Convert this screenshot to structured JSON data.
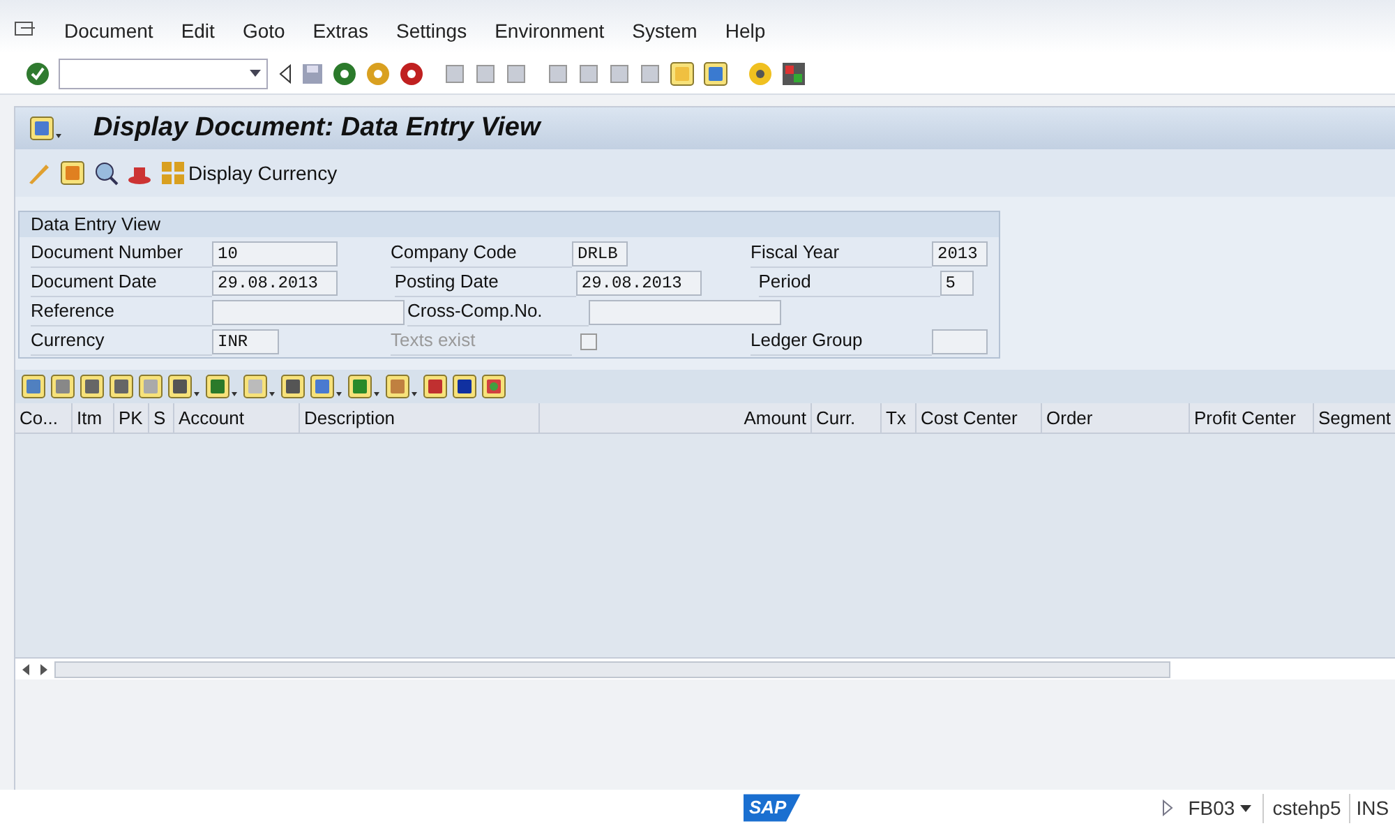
{
  "menu_bar": {
    "items": [
      "Document",
      "Edit",
      "Goto",
      "Extras",
      "Settings",
      "Environment",
      "System",
      "Help"
    ]
  },
  "title": "Display Document: Data Entry View",
  "app_toolbar": {
    "button_label": "Display Currency"
  },
  "panel": {
    "title": "Data Entry View",
    "rows": [
      [
        {
          "kind": "field",
          "label": "Document Number",
          "value": "10"
        },
        {
          "kind": "field",
          "label": "Company Code",
          "value": "DRLB"
        },
        {
          "kind": "field",
          "label": "Fiscal Year",
          "value": "2013"
        }
      ],
      [
        {
          "kind": "field",
          "label": "Document Date",
          "value": "29.08.2013"
        },
        {
          "kind": "field",
          "label": "Posting Date",
          "value": "29.08.2013"
        },
        {
          "kind": "field",
          "label": "Period",
          "value": "5"
        }
      ],
      [
        {
          "kind": "field",
          "label": "Reference"
        },
        {
          "kind": "field",
          "label": "Cross-Comp.No."
        }
      ],
      [
        {
          "kind": "field",
          "label": "Currency",
          "value": "INR"
        },
        {
          "kind": "checkbox",
          "label": "Texts exist",
          "disabled": true,
          "checked": false
        },
        {
          "kind": "field",
          "label": "Ledger Group"
        }
      ]
    ]
  },
  "grid": {
    "columns": [
      "Co...",
      "Itm",
      "PK",
      "S",
      "Account",
      "Description",
      "Amount",
      "Curr.",
      "Tx",
      "Cost Center",
      "Order",
      "Profit Center",
      "Segment"
    ]
  },
  "status_bar": {
    "logo": "SAP",
    "transaction": "FB03",
    "server": "cstehp5",
    "mode": "INS"
  }
}
